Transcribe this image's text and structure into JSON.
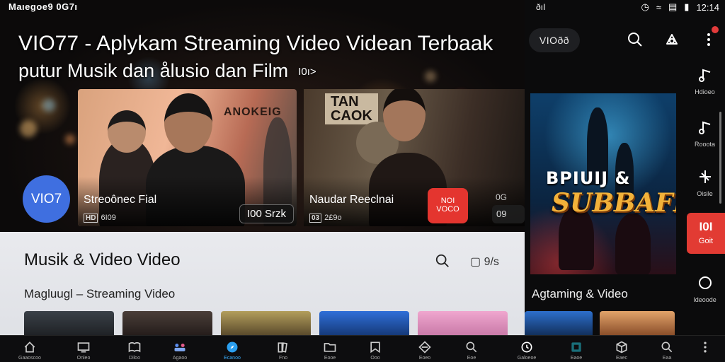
{
  "status_left": "Maıegoe9 0G7ı",
  "hero": {
    "title": "VIO77 - Aplykam Streaming Video Videan Terbaak",
    "subtitle": "putur Musik dan ålusio dan Film",
    "subtitle_badge": "I0ı>"
  },
  "cards": [
    {
      "poster_text": "ANOKEIG",
      "title": "Streoônec Fial",
      "meta_tag": "HD",
      "meta": "6I09",
      "pill": "I00 Srzk"
    },
    {
      "sign_text": "TAN\nCAOK",
      "title": "Naudar Reeclnai",
      "meta_tag": "03",
      "meta": "2£9o"
    }
  ],
  "logo_circle": "VIO7",
  "red_button": "NOI\nVOCO",
  "edge": {
    "top": "0G",
    "pill": "09"
  },
  "section": {
    "title": "Musik & Video Video",
    "subtitle": "Magluugl  –  Streaming Video",
    "copy_label": "9/s"
  },
  "right": {
    "status_left": "ðıI",
    "time": "12:14",
    "logo": "VIOðð",
    "poster_line1": "BPIUIJ &",
    "poster_line2": "SUBBAFK",
    "section": "Agtaming & Video",
    "rail": [
      {
        "label": "Hdioeo",
        "icon": "music-note-icon"
      },
      {
        "label": "Rooota",
        "icon": "music-note-icon"
      },
      {
        "label": "Oisile",
        "icon": "sparkle-icon"
      },
      {
        "label": "Ideoode",
        "icon": "circle-icon"
      }
    ],
    "rail_red": {
      "top": "I0I",
      "label": "Goit"
    }
  },
  "bottom_nav": [
    {
      "label": "Gaaoscoo",
      "icon": "home-icon"
    },
    {
      "label": "Onleo",
      "icon": "tv-icon"
    },
    {
      "label": "Diloo",
      "icon": "book-icon"
    },
    {
      "label": "Agaoo",
      "icon": "people-icon"
    },
    {
      "label": "Ecanoo",
      "icon": "compass-icon",
      "active": true
    },
    {
      "label": "Fno",
      "icon": "library-icon"
    },
    {
      "label": "Eooe",
      "icon": "folder-icon"
    },
    {
      "label": "Ooo",
      "icon": "bookmark-icon"
    },
    {
      "label": "Eoeo",
      "icon": "diamond-icon"
    },
    {
      "label": "Eoe",
      "icon": "search-icon"
    },
    {
      "label": "Galoeoe",
      "icon": "timer-icon"
    },
    {
      "label": "Eaoe",
      "icon": "screen-icon"
    },
    {
      "label": "Eaec",
      "icon": "cube-icon"
    },
    {
      "label": "Eaa",
      "icon": "search-icon"
    },
    {
      "label": "",
      "icon": "more-icon"
    }
  ],
  "colors": {
    "accent_blue": "#3f6fe0",
    "accent_red": "#e4352f",
    "active_nav": "#3ab0ff"
  }
}
